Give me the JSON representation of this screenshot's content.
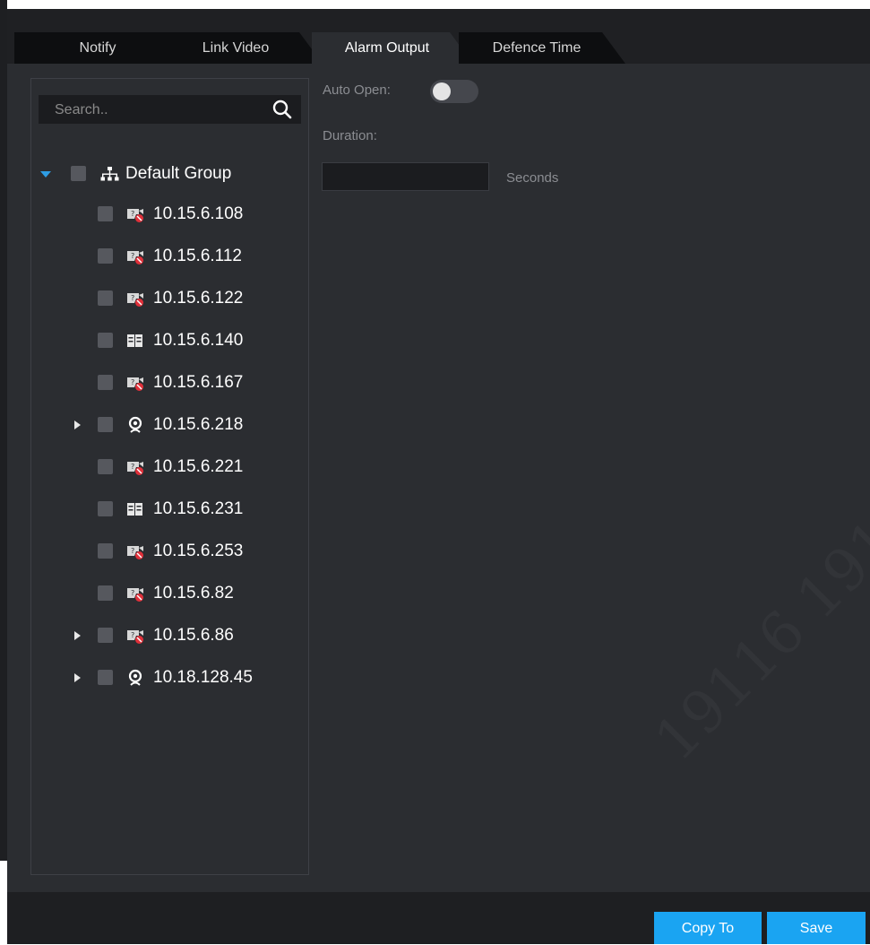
{
  "tabs": [
    {
      "label": "Notify",
      "active": false
    },
    {
      "label": "Link Video",
      "active": false
    },
    {
      "label": "Alarm Output",
      "active": true
    },
    {
      "label": "Defence Time",
      "active": false
    }
  ],
  "search": {
    "placeholder": "Search.."
  },
  "tree": {
    "root": {
      "label": "Default Group",
      "expanded": true,
      "icon": "group-icon"
    },
    "items": [
      {
        "label": "10.15.6.108",
        "icon": "offline-camera-icon",
        "expandable": false
      },
      {
        "label": "10.15.6.112",
        "icon": "offline-camera-icon",
        "expandable": false
      },
      {
        "label": "10.15.6.122",
        "icon": "offline-camera-icon",
        "expandable": false
      },
      {
        "label": "10.15.6.140",
        "icon": "nvr-icon",
        "expandable": false
      },
      {
        "label": "10.15.6.167",
        "icon": "offline-camera-icon",
        "expandable": false
      },
      {
        "label": "10.15.6.218",
        "icon": "ip-camera-icon",
        "expandable": true
      },
      {
        "label": "10.15.6.221",
        "icon": "offline-camera-icon",
        "expandable": false
      },
      {
        "label": "10.15.6.231",
        "icon": "nvr-icon",
        "expandable": false
      },
      {
        "label": "10.15.6.253",
        "icon": "offline-camera-icon",
        "expandable": false
      },
      {
        "label": "10.15.6.82",
        "icon": "offline-camera-icon",
        "expandable": false
      },
      {
        "label": "10.15.6.86",
        "icon": "offline-camera-icon",
        "expandable": true
      },
      {
        "label": "10.18.128.45",
        "icon": "ip-camera-icon",
        "expandable": true
      }
    ]
  },
  "settings": {
    "auto_open_label": "Auto Open:",
    "auto_open_enabled": false,
    "duration_label": "Duration:",
    "duration_value": "",
    "duration_unit": "Seconds"
  },
  "footer": {
    "copy_to_label": "Copy To",
    "save_label": "Save"
  },
  "colors": {
    "accent": "#1aa4f2",
    "background": "#2b2d31",
    "tabbar": "#1f2023",
    "offline_badge": "#e0303a"
  }
}
